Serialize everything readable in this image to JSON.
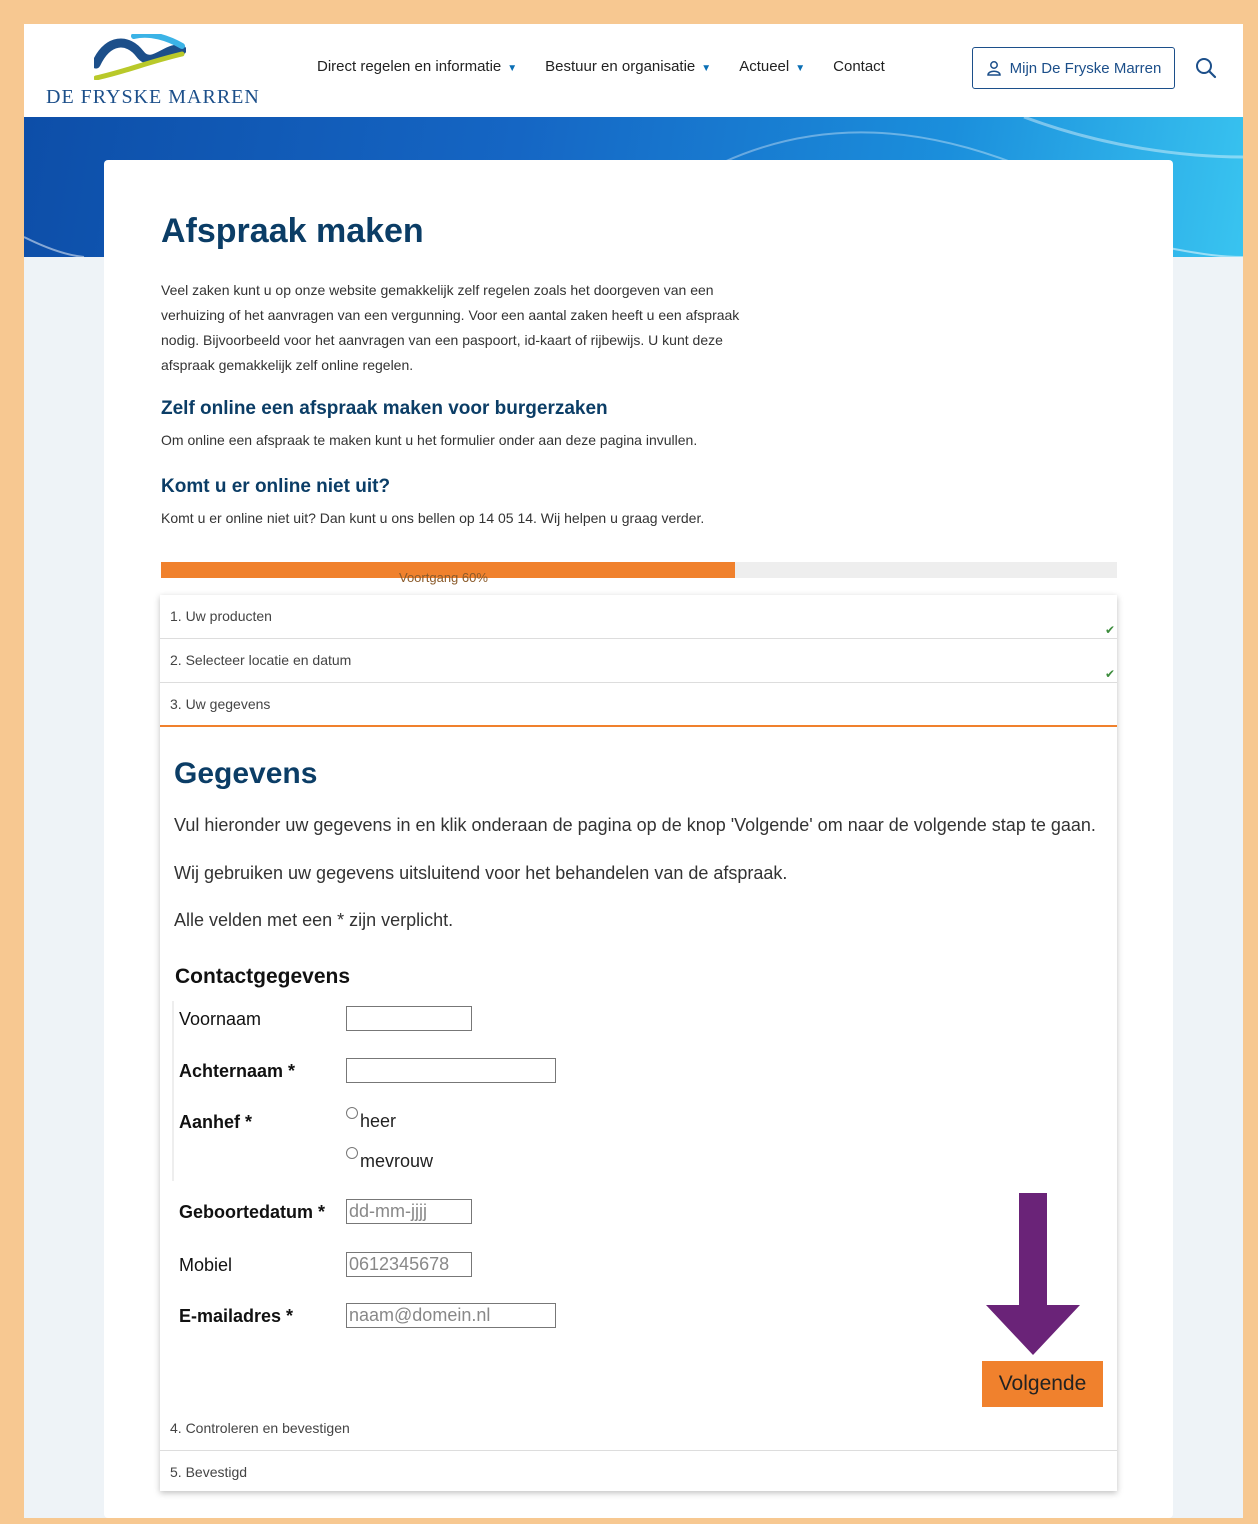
{
  "header": {
    "logo_text": "DE FRYSKE MARREN",
    "nav": [
      {
        "label": "Direct regelen en informatie"
      },
      {
        "label": "Bestuur en organisatie"
      },
      {
        "label": "Actueel"
      },
      {
        "label": "Contact"
      }
    ],
    "account_button": "Mijn De Fryske Marren",
    "search_icon": "search-icon"
  },
  "page": {
    "title": "Afspraak maken",
    "intro": "Veel zaken kunt u op onze website gemakkelijk zelf regelen zoals het doorgeven van een verhuizing of het aanvragen van een vergunning. Voor een aantal zaken heeft u een afspraak nodig. Bijvoorbeeld voor het aanvragen van een paspoort, id-kaart of rijbewijs. U kunt deze afspraak gemakkelijk zelf online regelen.",
    "section1_title": "Zelf online een afspraak maken voor burgerzaken",
    "section1_text": "Om online een afspraak te maken kunt u het formulier onder aan deze pagina invullen.",
    "section2_title": "Komt u er online niet uit?",
    "section2_text": "Komt u er online niet uit? Dan kunt u ons bellen op 14 05 14. Wij helpen u graag verder."
  },
  "progress": {
    "label": "Voortgang 60%",
    "value_percent": 60
  },
  "steps": [
    {
      "label": "1. Uw producten",
      "done": true
    },
    {
      "label": "2. Selecteer locatie en datum",
      "done": true
    },
    {
      "label": "3. Uw gegevens",
      "done": false
    },
    {
      "label": "4. Controleren en bevestigen",
      "done": false
    },
    {
      "label": "5. Bevestigd",
      "done": false
    }
  ],
  "form": {
    "title": "Gegevens",
    "p1": "Vul hieronder uw gegevens in en klik onderaan de pagina op de knop 'Volgende' om naar de volgende stap te gaan.",
    "p2": "Wij gebruiken uw gegevens uitsluitend voor het behandelen van de afspraak.",
    "p3": "Alle velden met een * zijn verplicht.",
    "section_title": "Contactgegevens",
    "fields": {
      "voornaam": {
        "label": "Voornaam",
        "value": "",
        "placeholder": ""
      },
      "achternaam": {
        "label": "Achternaam *",
        "value": "",
        "placeholder": ""
      },
      "aanhef": {
        "label": "Aanhef *",
        "options": [
          "heer",
          "mevrouw"
        ]
      },
      "geboortedatum": {
        "label": "Geboortedatum *",
        "value": "",
        "placeholder": "dd-mm-jjjj"
      },
      "mobiel": {
        "label": "Mobiel",
        "value": "",
        "placeholder": "0612345678"
      },
      "email": {
        "label": "E-mailadres *",
        "value": "",
        "placeholder": "naam@domein.nl"
      }
    },
    "next_button": "Volgende"
  },
  "colors": {
    "accent": "#f0812d",
    "heading": "#0b3d66",
    "annotation_arrow": "#6a2378",
    "border": "#f7c891"
  }
}
